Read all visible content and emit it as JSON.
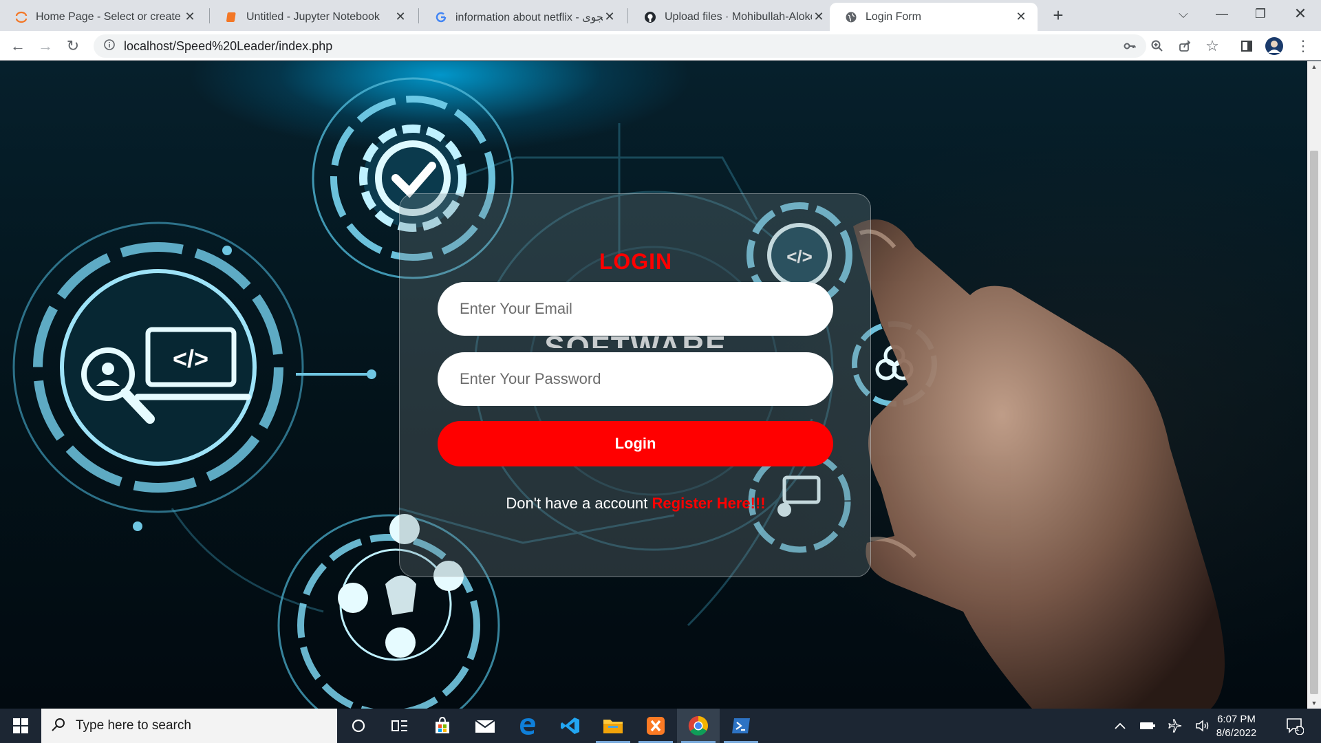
{
  "browser": {
    "tabs": [
      {
        "title": "Home Page - Select or create a n",
        "icon": "jupyter-icon",
        "active": false
      },
      {
        "title": "Untitled - Jupyter Notebook",
        "icon": "notebook-icon",
        "active": false
      },
      {
        "title": "information about netflix - جستجوی",
        "icon": "google-icon",
        "active": false
      },
      {
        "title": "Upload files · Mohibullah-Alokoz",
        "icon": "github-icon",
        "active": false
      },
      {
        "title": "Login Form",
        "icon": "globe-icon",
        "active": true
      }
    ],
    "url": "localhost/Speed%20Leader/index.php"
  },
  "login": {
    "title": "LOGIN",
    "email_placeholder": "Enter Your Email",
    "password_placeholder": "Enter Your Password",
    "button_label": "Login",
    "register_prompt": "Don't have a account",
    "register_link": "Register Here!!!"
  },
  "background_watermark": "SOFTWARE",
  "taskbar": {
    "search_placeholder": "Type here to search",
    "time": "6:07 PM",
    "date": "8/6/2022",
    "notification_count": "1"
  },
  "colors": {
    "accent": "#ff0000",
    "tabstrip": "#dee1e6",
    "taskbar": "#1c2633",
    "glow": "#39c6f0"
  }
}
